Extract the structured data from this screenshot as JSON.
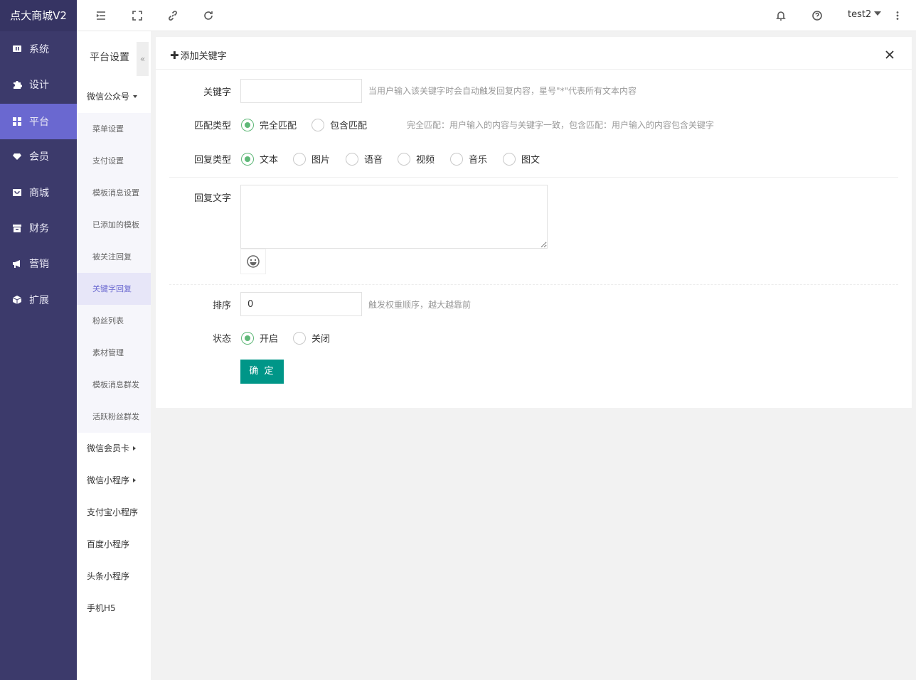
{
  "brand": "点大商城V2",
  "nav": [
    {
      "label": "系统",
      "icon": "monitor-icon"
    },
    {
      "label": "设计",
      "icon": "puzzle-icon"
    },
    {
      "label": "平台",
      "icon": "grid-icon"
    },
    {
      "label": "会员",
      "icon": "diamond-icon"
    },
    {
      "label": "商城",
      "icon": "shop-icon"
    },
    {
      "label": "财务",
      "icon": "wallet-icon"
    },
    {
      "label": "营销",
      "icon": "megaphone-icon"
    },
    {
      "label": "扩展",
      "icon": "cube-icon"
    }
  ],
  "header": {
    "user": "test2"
  },
  "subnav": {
    "title": "平台设置",
    "collapse_glyph": "«",
    "group_wechat": "微信公众号",
    "items": [
      "菜单设置",
      "支付设置",
      "模板消息设置",
      "已添加的模板",
      "被关注回复",
      "关键字回复",
      "粉丝列表",
      "素材管理",
      "模板消息群发",
      "活跃粉丝群发"
    ],
    "groups_after": [
      "微信会员卡",
      "微信小程序",
      "支付宝小程序",
      "百度小程序",
      "头条小程序",
      "手机H5"
    ]
  },
  "form": {
    "title_glyph": "✚",
    "title": "添加关键字",
    "keyword_label": "关键字",
    "keyword_value": "",
    "keyword_hint": "当用户输入该关键字时会自动触发回复内容，星号\"*\"代表所有文本内容",
    "match_label": "匹配类型",
    "match_options": [
      "完全匹配",
      "包含匹配"
    ],
    "match_hint": "完全匹配：用户输入的内容与关键字一致，包含匹配：用户输入的内容包含关键字",
    "reply_type_label": "回复类型",
    "reply_types": [
      "文本",
      "图片",
      "语音",
      "视频",
      "音乐",
      "图文"
    ],
    "reply_text_label": "回复文字",
    "sort_label": "排序",
    "sort_value": "0",
    "sort_hint": "触发权重顺序，越大越靠前",
    "status_label": "状态",
    "status_options": [
      "开启",
      "关闭"
    ],
    "submit": "确 定"
  },
  "colors": {
    "sidebar": "#3c3a6b",
    "active": "#6a68d0",
    "primary": "#009688",
    "radio_on": "#5fb878"
  }
}
